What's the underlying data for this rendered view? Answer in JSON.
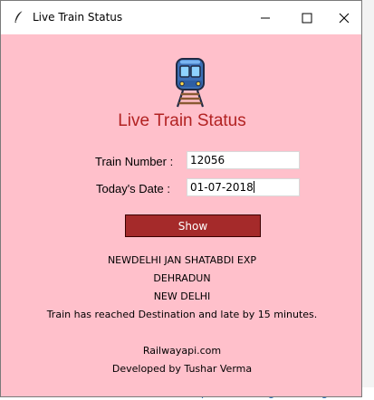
{
  "window": {
    "title": "Live Train Status"
  },
  "app": {
    "heading": "Live Train Status",
    "train_number_label": "Train Number :",
    "train_number_value": "12056",
    "date_label": "Today's Date :",
    "date_value": "01-07-2018",
    "show_button": "Show"
  },
  "result": {
    "train_name": "NEWDELHI JAN SHATABDI EXP",
    "source": "DEHRADUN",
    "destination": "NEW DELHI",
    "status": "Train has reached Destination and late by 15 minutes."
  },
  "footer": {
    "api_credit": "Railwayapi.com",
    "developer": "Developed by Tushar Verma"
  },
  "background": {
    "bottom_link": "Competitive Programming",
    "stars": "★★★"
  },
  "colors": {
    "window_bg": "#ffc0cb",
    "heading": "#b22222",
    "button_bg": "#a52a2a"
  }
}
